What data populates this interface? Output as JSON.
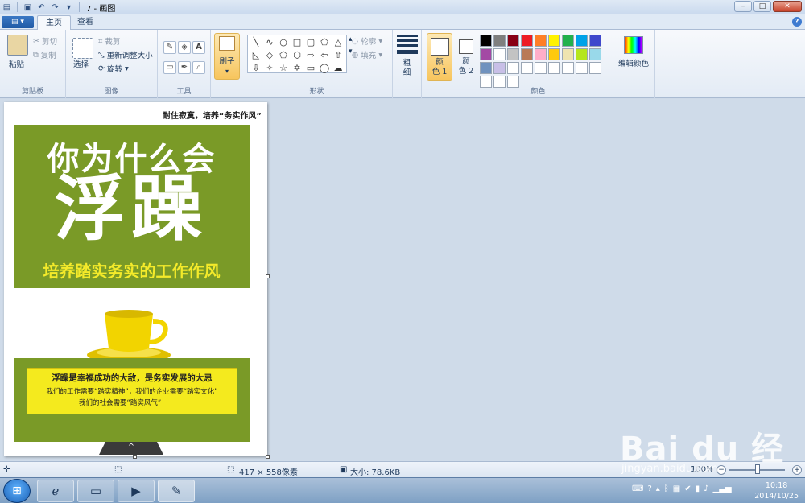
{
  "window": {
    "title": "7 - 画图",
    "file_menu_icon": "file-menu-icon",
    "btn_minimize": "–",
    "btn_maximize": "□",
    "btn_close": "✕"
  },
  "tabs": [
    {
      "label": "主页",
      "active": true
    },
    {
      "label": "查看",
      "active": false
    }
  ],
  "ribbon": {
    "clipboard": {
      "paste": "粘贴",
      "cut": "剪切",
      "copy": "复制",
      "group": "剪贴板"
    },
    "image": {
      "select": "选择",
      "crop": "裁剪",
      "resize": "重新调整大小",
      "rotate": "旋转",
      "group": "图像"
    },
    "tools": {
      "group": "工具"
    },
    "brush": {
      "label": "刷子"
    },
    "shapes": {
      "outline": "轮廓",
      "fill": "填充",
      "group": "形状"
    },
    "size": {
      "label_1": "粗",
      "label_2": "细"
    },
    "colors": {
      "color1_a": "颜",
      "color1_b": "色 1",
      "color2_a": "颜",
      "color2_b": "色 2",
      "edit": "编辑颜色",
      "group": "颜色"
    },
    "palette": [
      "#000000",
      "#7f7f7f",
      "#880015",
      "#ed1c24",
      "#ff7f27",
      "#fff200",
      "#22b14c",
      "#00a2e8",
      "#3f48cc",
      "#a349a4",
      "#ffffff",
      "#c3c3c3",
      "#b97a57",
      "#ffaec9",
      "#ffc90e",
      "#efe4b0",
      "#b5e61d",
      "#99d9ea",
      "#7092be",
      "#c8bfe7",
      "#ffffff",
      "#ffffff",
      "#ffffff",
      "#ffffff",
      "#ffffff",
      "#ffffff",
      "#ffffff",
      "#ffffff",
      "#ffffff",
      "#ffffff"
    ]
  },
  "canvas": {
    "tagline": "耐住寂寞，培养“务实作风”",
    "title_line1": "你为什么会",
    "title_line2": "浮躁",
    "subtitle": "培养踏实务实的工作作风",
    "msg_line1": "浮躁是幸福成功的大敌，是务实发展的大忌",
    "msg_line2": "我们的工作需要“踏实精神”，我们的企业需要“踏实文化”",
    "msg_line3": "我们的社会需要“踏实风气”",
    "pager": "^"
  },
  "status": {
    "dimensions": "417 × 558像素",
    "filesize": "大小: 78.6KB",
    "zoom": "100%",
    "zoom_level": 1.0
  },
  "taskbar": {
    "time": "10:18",
    "date": "2014/10/25"
  },
  "watermark": {
    "text1": "Bai du 经验",
    "text2": "jingyan.baidu.com"
  }
}
